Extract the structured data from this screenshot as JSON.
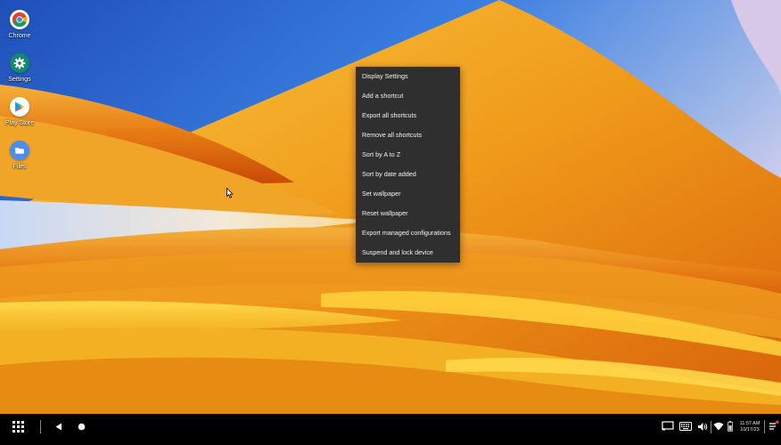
{
  "desktop": {
    "icons": [
      {
        "label": "Chrome",
        "icon": "chrome-icon"
      },
      {
        "label": "Settings",
        "icon": "gear-icon"
      },
      {
        "label": "Play Store",
        "icon": "play-store-icon"
      },
      {
        "label": "Files",
        "icon": "folder-icon"
      }
    ]
  },
  "context_menu": {
    "items": [
      "Display Settings",
      "Add a shortcut",
      "Export all shortcuts",
      "Remove all shortcuts",
      "Sort by A to Z",
      "Sort by date added",
      "Set wallpaper",
      "Reset wallpaper",
      "Export managed configurations",
      "Suspend and lock device"
    ]
  },
  "taskbar": {
    "launcher_icon": "grid-icon",
    "back_icon": "back-triangle-icon",
    "home_icon": "home-dot-icon",
    "tray": {
      "time": "11:57 AM",
      "date": "10/17/23",
      "icons": [
        "screen-cast-icon",
        "keyboard-icon",
        "volume-icon",
        "wifi-icon",
        "battery-icon",
        "notifications-icon"
      ]
    }
  },
  "colors": {
    "menu_bg": "#2f2f2f",
    "menu_text": "#f2f2f2",
    "taskbar_bg": "#000000",
    "notification_dot": "#e53935"
  }
}
